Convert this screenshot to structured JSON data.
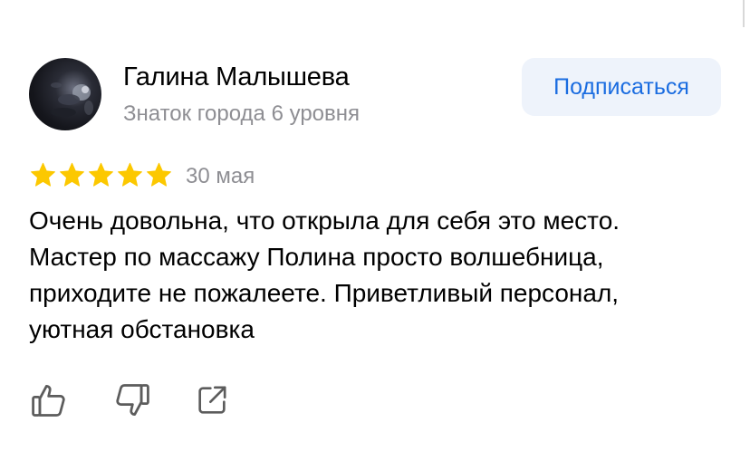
{
  "user": {
    "name": "Галина Малышева",
    "level": "Знаток города 6 уровня"
  },
  "subscribe": {
    "label": "Подписаться"
  },
  "review": {
    "rating": 5,
    "rating_max": 5,
    "date": "30 мая",
    "text_lines": [
      "Очень довольна, что открыла для себя это место.",
      "Мастер по массажу Полина просто волшебница,",
      "приходите не пожалеете. Приветливый персонал,",
      "уютная обстановка"
    ]
  },
  "actions": [
    {
      "icon": "thumbs-up-icon"
    },
    {
      "icon": "thumbs-down-icon"
    },
    {
      "icon": "share-icon"
    }
  ],
  "colors": {
    "accent": "#1a6ce0",
    "button_bg": "#eef3fb",
    "star": "#fcc800",
    "muted_text": "#8e8e93",
    "icon": "#5c5c5c"
  }
}
